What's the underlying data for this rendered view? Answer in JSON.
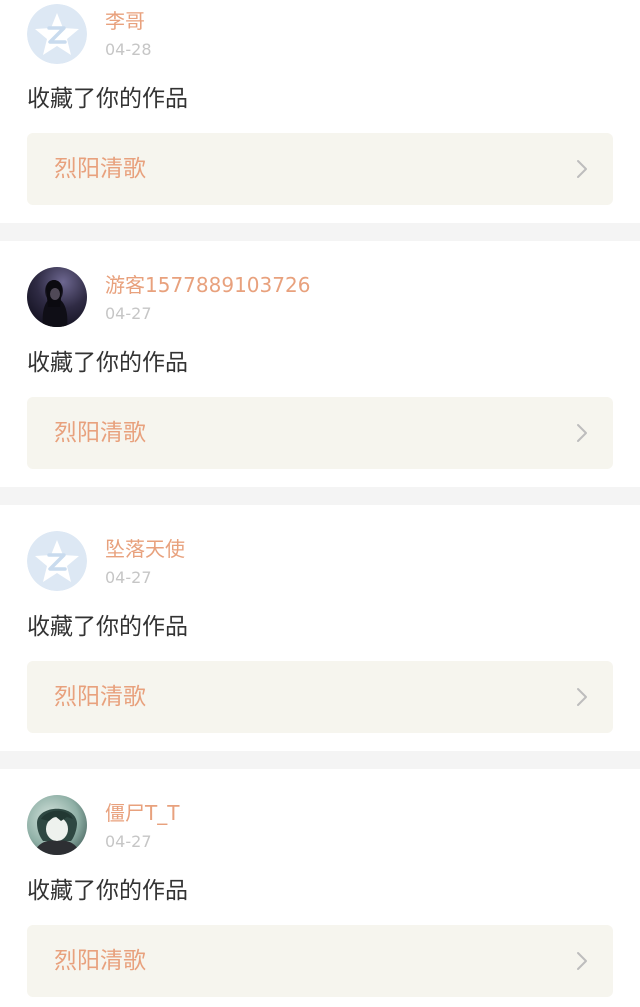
{
  "notifications": [
    {
      "avatar_icon": "default-star-avatar-icon",
      "username": "李哥",
      "date": "04-28",
      "action": "收藏了你的作品",
      "work_title": "烈阳清歌"
    },
    {
      "avatar_icon": "user-photo-avatar",
      "username": "游客1577889103726",
      "date": "04-27",
      "action": "收藏了你的作品",
      "work_title": "烈阳清歌"
    },
    {
      "avatar_icon": "default-star-avatar-icon",
      "username": "坠落天使",
      "date": "04-27",
      "action": "收藏了你的作品",
      "work_title": "烈阳清歌"
    },
    {
      "avatar_icon": "user-photo-avatar",
      "username": "僵尸T_T",
      "date": "04-27",
      "action": "收藏了你的作品",
      "work_title": "烈阳清歌"
    }
  ],
  "colors": {
    "accent": "#e8a17d",
    "date_gray": "#c6c6c6",
    "text": "#333333",
    "work_bg": "#f6f5ee",
    "separator": "#f4f4f4"
  }
}
